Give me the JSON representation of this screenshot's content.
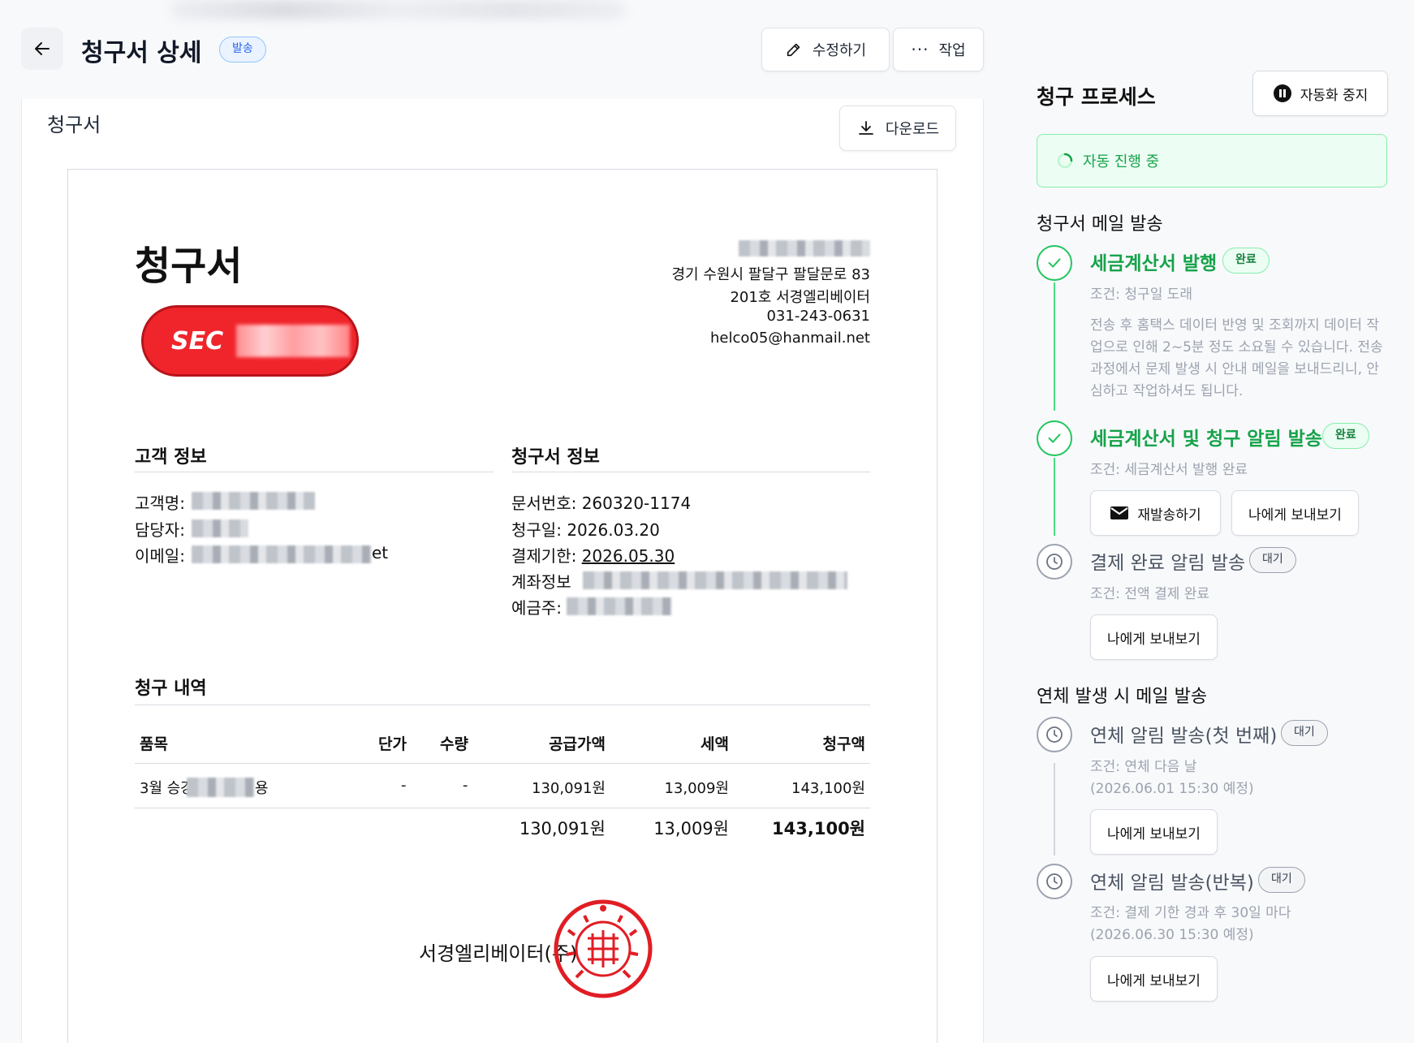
{
  "header": {
    "title": "청구서 상세",
    "status_badge": "발송",
    "edit_label": "수정하기",
    "actions_label": "작업"
  },
  "invoice_card": {
    "title": "청구서",
    "download_label": "다운로드"
  },
  "document": {
    "title": "청구서",
    "stamp_text": "SEC",
    "address_line1": "경기 수원시 팔달구 팔달문로 83",
    "address_line2": "201호 서경엘리베이터",
    "phone": "031-243-0631",
    "email": "helco05@hanmail.net",
    "customer_section": {
      "title": "고객 정보",
      "customer_name_label": "고객명:",
      "contact_label": "담당자:",
      "email_label": "이메일:",
      "email_suffix": "et"
    },
    "invoice_section": {
      "title": "청구서 정보",
      "doc_no_label": "문서번호:",
      "doc_no": "260320-1174",
      "date_label": "청구일:",
      "date": "2026.03.20",
      "due_label": "결제기한:",
      "due": "2026.05.30",
      "account_label": "계좌정보",
      "holder_label": "예금주:"
    },
    "items_section": {
      "title": "청구 내역",
      "columns": [
        "품목",
        "단가",
        "수량",
        "공급가액",
        "세액",
        "청구액"
      ],
      "row": {
        "item_prefix": "3월 승강",
        "item_suffix": "용",
        "unit_price": "-",
        "qty": "-",
        "supply": "130,091원",
        "tax": "13,009원",
        "amount": "143,100원"
      },
      "totals": {
        "supply": "130,091원",
        "tax": "13,009원",
        "amount": "143,100원"
      }
    },
    "company_name": "서경엘리베이터(주)"
  },
  "process": {
    "title": "청구 프로세스",
    "pause_label": "자동화 중지",
    "auto_status": "자동 진행 중",
    "group1_title": "청구서 메일 발송",
    "step1": {
      "name": "세금계산서 발행",
      "status": "완료",
      "condition": "조건: 청구일 도래",
      "desc_lines": [
        "전송 후 홈택스 데이터 반영 및 조회까지 데이터 작",
        "업으로 인해 2~5분 정도 소요될 수 있습니다. 전송",
        "과정에서 문제 발생 시 안내 메일을 보내드리니, 안",
        "심하고 작업하셔도 됩니다."
      ]
    },
    "step2": {
      "name": "세금계산서 및 청구 알림 발송",
      "status": "완료",
      "condition": "조건: 세금계산서 발행 완료",
      "resend_label": "재발송하기",
      "send_me_label": "나에게 보내보기"
    },
    "step3": {
      "name": "결제 완료 알림 발송",
      "status": "대기",
      "condition": "조건: 전액 결제 완료",
      "send_me_label": "나에게 보내보기"
    },
    "group2_title": "연체 발생 시 메일 발송",
    "step4": {
      "name": "연체 알림 발송(첫 번째)",
      "status": "대기",
      "condition_line1": "조건: 연체 다음 날",
      "condition_line2": "(2026.06.01 15:30 예정)",
      "send_me_label": "나에게 보내보기"
    },
    "step5": {
      "name": "연체 알림 발송(반복)",
      "status": "대기",
      "condition_line1": "조건: 결제 기한 경과 후 30일 마다",
      "condition_line2": "(2026.06.30 15:30 예정)",
      "send_me_label": "나에게 보내보기"
    }
  },
  "colors": {
    "success": "#16a34a",
    "accent_blue": "#2563eb",
    "stamp_red": "#e11d24"
  }
}
